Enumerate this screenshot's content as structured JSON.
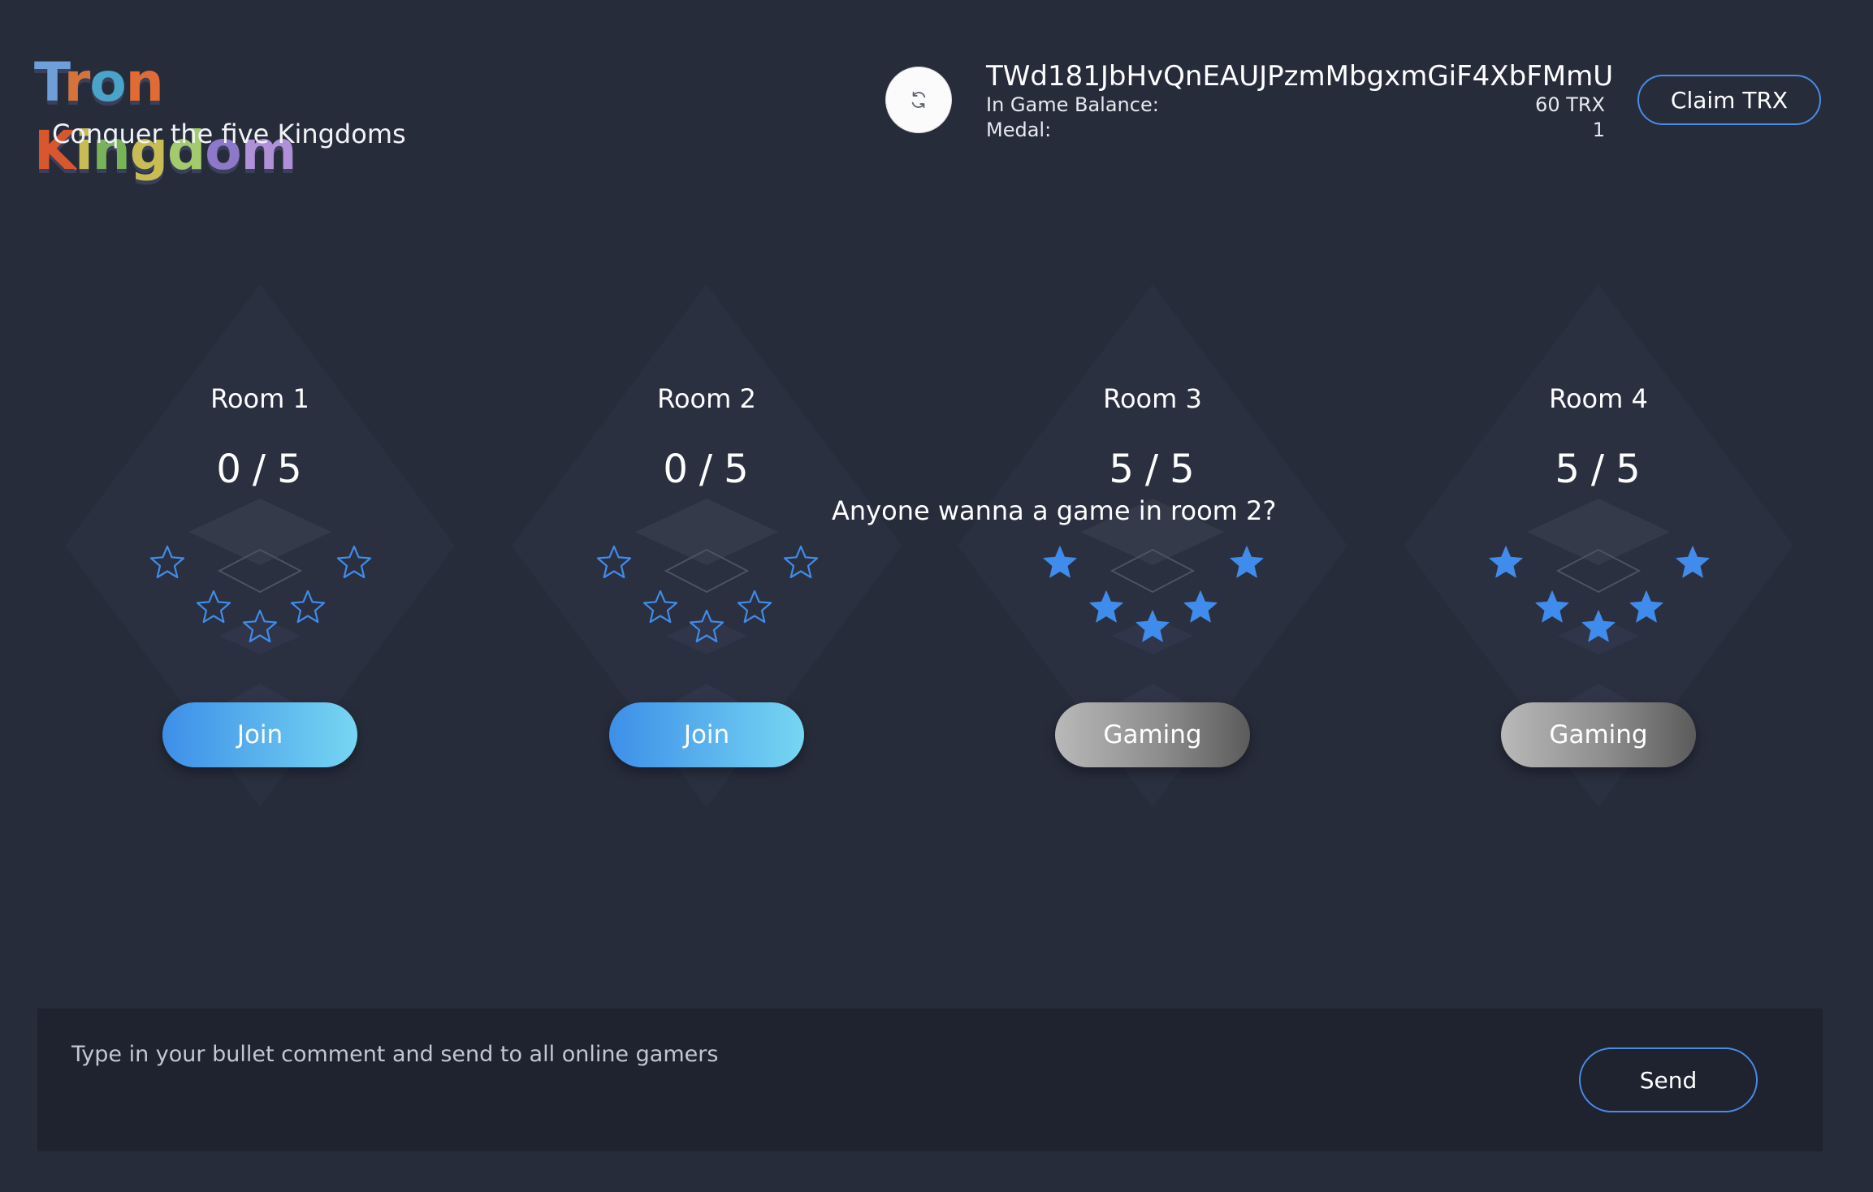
{
  "header": {
    "logo_text": "Tron Kingdom",
    "tagline": "Conquer the five Kingdoms",
    "refresh_icon": "refresh-icon",
    "account": {
      "address": "TWd181JbHvQnEAUJPzmMbgxmGiF4XbFMmU",
      "balance_label": "In Game Balance:",
      "balance_value": "60 TRX",
      "medal_label": "Medal:",
      "medal_value": "1"
    },
    "claim_label": "Claim TRX"
  },
  "rooms": [
    {
      "name": "Room 1",
      "current": "0",
      "capacity": "5",
      "button_label": "Join",
      "status": "open",
      "filled_stars": 0
    },
    {
      "name": "Room 2",
      "current": "0",
      "capacity": "5",
      "button_label": "Join",
      "status": "open",
      "filled_stars": 0
    },
    {
      "name": "Room 3",
      "current": "5",
      "capacity": "5",
      "button_label": "Gaming",
      "status": "gaming",
      "filled_stars": 5
    },
    {
      "name": "Room 4",
      "current": "5",
      "capacity": "5",
      "button_label": "Gaming",
      "status": "gaming",
      "filled_stars": 5
    }
  ],
  "count_separator": "/",
  "bullet_comment": "Anyone wanna a game in room 2?",
  "comment": {
    "placeholder": "Type in your bullet comment and send to all online gamers",
    "value": "",
    "send_label": "Send"
  },
  "colors": {
    "background": "#272c3b",
    "accent_blue": "#4a8be6",
    "star_blue": "#3f8cec",
    "comment_bar": "#1f2330"
  }
}
